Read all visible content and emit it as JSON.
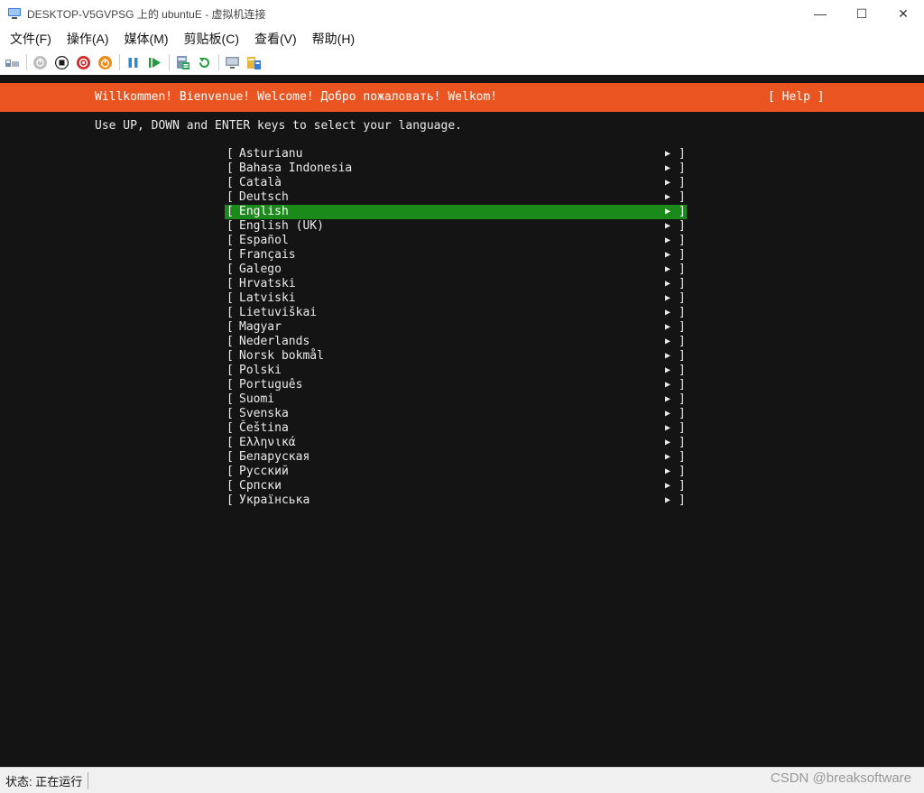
{
  "window": {
    "title": "DESKTOP-V5GVPSG 上的 ubuntuE - 虚拟机连接",
    "minimize": "—",
    "maximize": "☐",
    "close": "✕"
  },
  "menu": [
    "文件(F)",
    "操作(A)",
    "媒体(M)",
    "剪贴板(C)",
    "查看(V)",
    "帮助(H)"
  ],
  "toolbar": {
    "icons": [
      "ctrl-alt-del-icon",
      "start-icon",
      "turn-off-icon",
      "shutdown-icon",
      "save-icon",
      "pause-icon",
      "resume-icon",
      "checkpoint-icon",
      "revert-icon",
      "enhanced-session-icon",
      "share-icon"
    ]
  },
  "console": {
    "welcome": "Willkommen! Bienvenue! Welcome! Добро пожаловать! Welkom!",
    "help": "[ Help ]",
    "instruction": "Use UP, DOWN and ENTER keys to select your language.",
    "languages": [
      "Asturianu",
      "Bahasa Indonesia",
      "Català",
      "Deutsch",
      "English",
      "English (UK)",
      "Español",
      "Français",
      "Galego",
      "Hrvatski",
      "Latviski",
      "Lietuviškai",
      "Magyar",
      "Nederlands",
      "Norsk bokmål",
      "Polski",
      "Português",
      "Suomi",
      "Svenska",
      "Čeština",
      "Ελληνικά",
      "Беларуская",
      "Русский",
      "Српски",
      "Українська"
    ],
    "selected_index": 4,
    "bracket_open": "[",
    "bracket_close": "]",
    "arrow": "▶"
  },
  "status": {
    "label": "状态: 正在运行",
    "watermark": "CSDN @breaksoftware"
  },
  "colors": {
    "header": "#e95420",
    "selection": "#1a8a1a",
    "console_bg": "#141414"
  }
}
